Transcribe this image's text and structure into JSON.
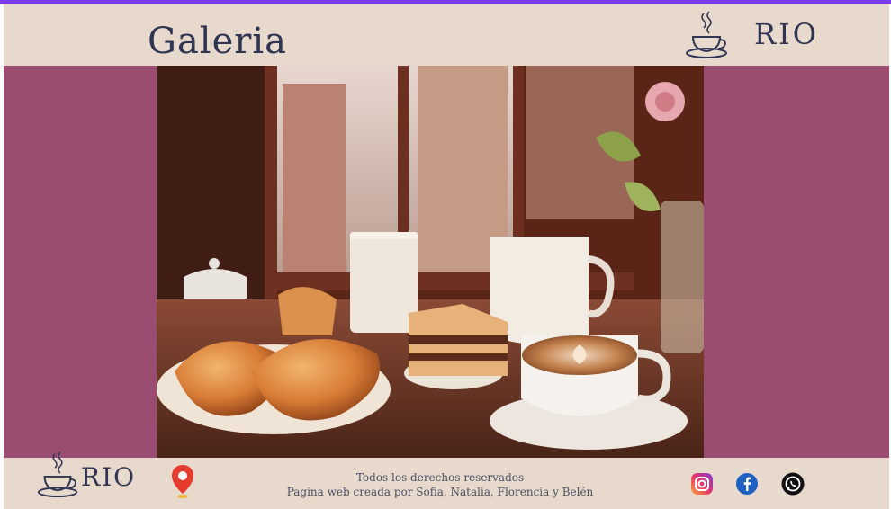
{
  "header": {
    "title": "Galeria",
    "brand": "RIO"
  },
  "gallery": {
    "image_alt": "Breakfast with croissants, cake, milk and cappuccino by a window overlooking a city street"
  },
  "footer": {
    "brand": "RIO",
    "rights": "Todos los derechos reservados",
    "credit": "Pagina web creada por Sofia, Natalia, Florencia y Belén"
  },
  "colors": {
    "accent_bar": "#7b3cf0",
    "background": "#e7d9cc",
    "gallery_bg": "#9b4d71",
    "text": "#2f3552"
  },
  "icons": {
    "location": "location-pin-icon",
    "instagram": "instagram-icon",
    "facebook": "facebook-icon",
    "whatsapp": "whatsapp-icon"
  }
}
